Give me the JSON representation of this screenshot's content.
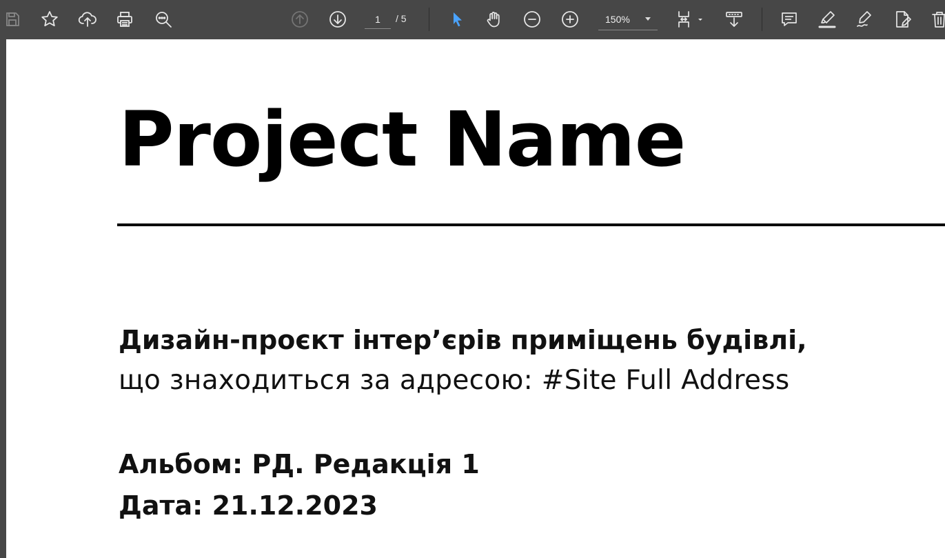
{
  "toolbar": {
    "current_page": "1",
    "total_pages": "/ 5",
    "zoom": "150%",
    "icons": [
      "save-icon",
      "bookmark-star-icon",
      "upload-cloud-icon",
      "print-icon",
      "find-icon",
      "previous-page-icon",
      "next-page-icon",
      "select-cursor-icon",
      "hand-tool-icon",
      "zoom-out-icon",
      "zoom-in-icon",
      "page-fit-icon",
      "scroll-mode-icon",
      "comment-icon",
      "highlight-icon",
      "draw-icon",
      "fill-sign-icon",
      "delete-icon"
    ]
  },
  "document": {
    "title": "Project Name",
    "description_bold": "Дизайн-проєкт інтер’єрів приміщень будівлі,",
    "description_light": "що знаходиться за адресою: #Site Full Address",
    "album": "Альбом: РД. Редакція 1",
    "date": "Дата: 21.12.2023"
  },
  "colors": {
    "toolbar_bg": "#474747",
    "icon": "#e6e6e6",
    "accent_select": "#4aa3ff",
    "page_bg": "#ffffff",
    "text": "#000000"
  }
}
